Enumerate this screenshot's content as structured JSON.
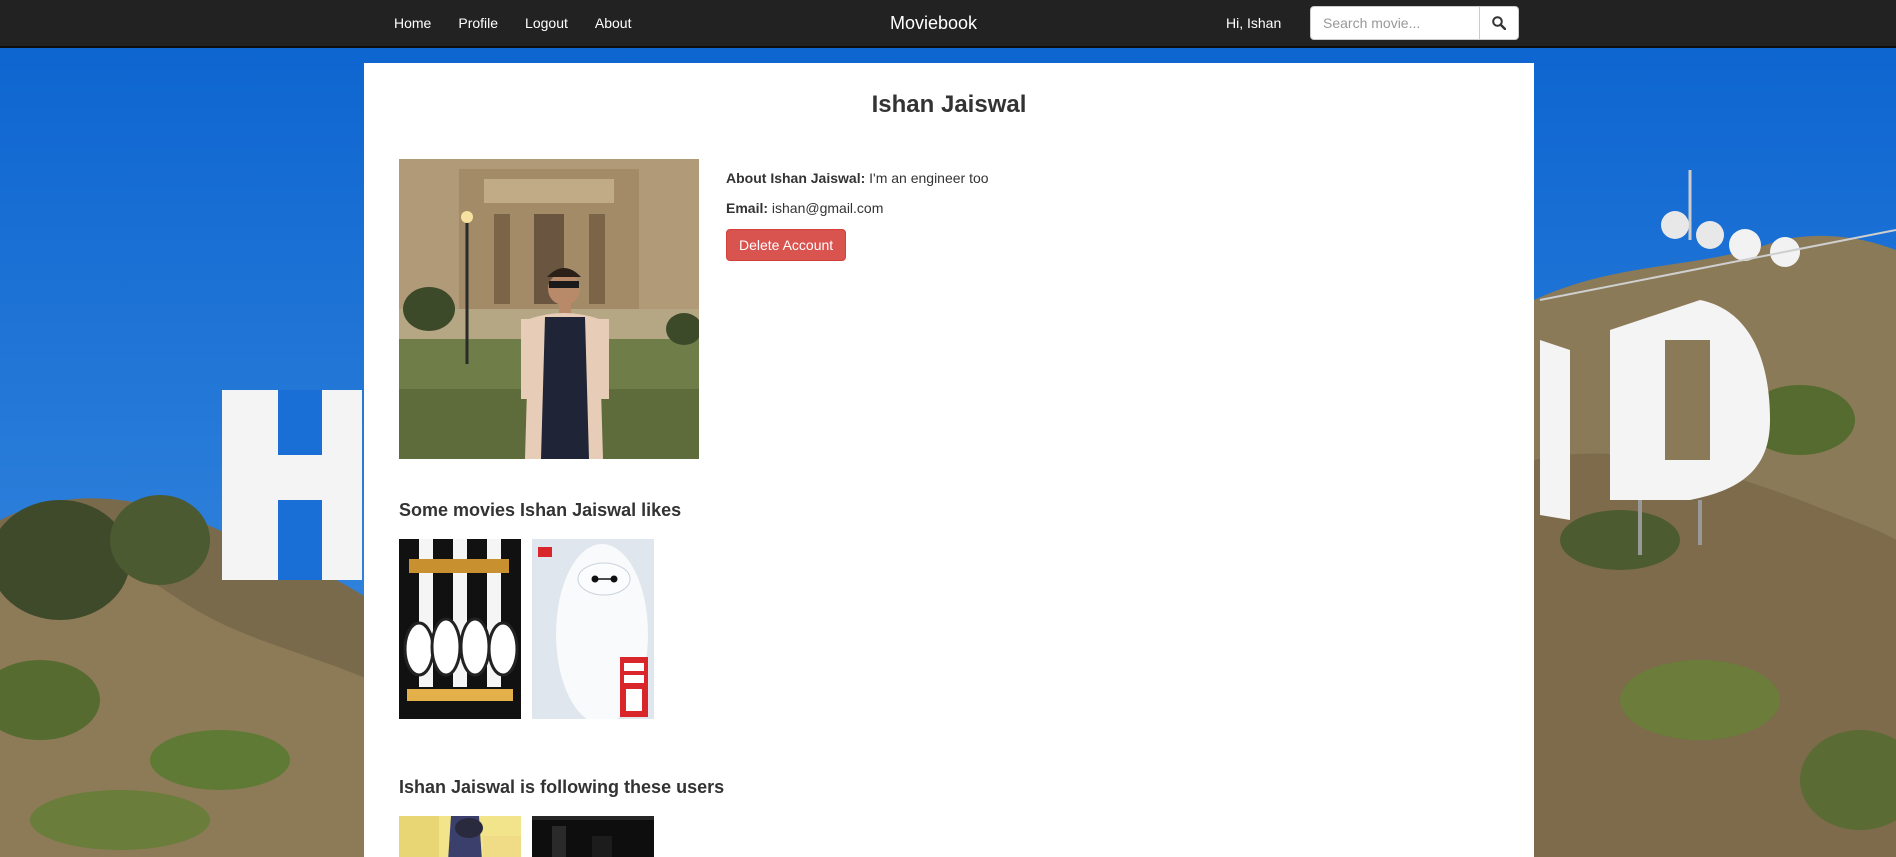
{
  "nav": {
    "links": [
      "Home",
      "Profile",
      "Logout",
      "About"
    ],
    "brand": "Moviebook",
    "greeting": "Hi, Ishan",
    "search_placeholder": "Search movie...",
    "search_icon": "search-icon"
  },
  "profile": {
    "name": "Ishan Jaiswal",
    "about_label": "About Ishan Jaiswal:",
    "about_value": "I'm an engineer too",
    "email_label": "Email:",
    "email_value": "ishan@gmail.com",
    "delete_label": "Delete Account"
  },
  "sections": {
    "movies_title": "Some movies Ishan Jaiswal likes",
    "following_title": "Ishan Jaiswal is following these users"
  },
  "colors": {
    "navbar": "#222222",
    "danger": "#d9534f",
    "sky": "#1a6fd6"
  }
}
